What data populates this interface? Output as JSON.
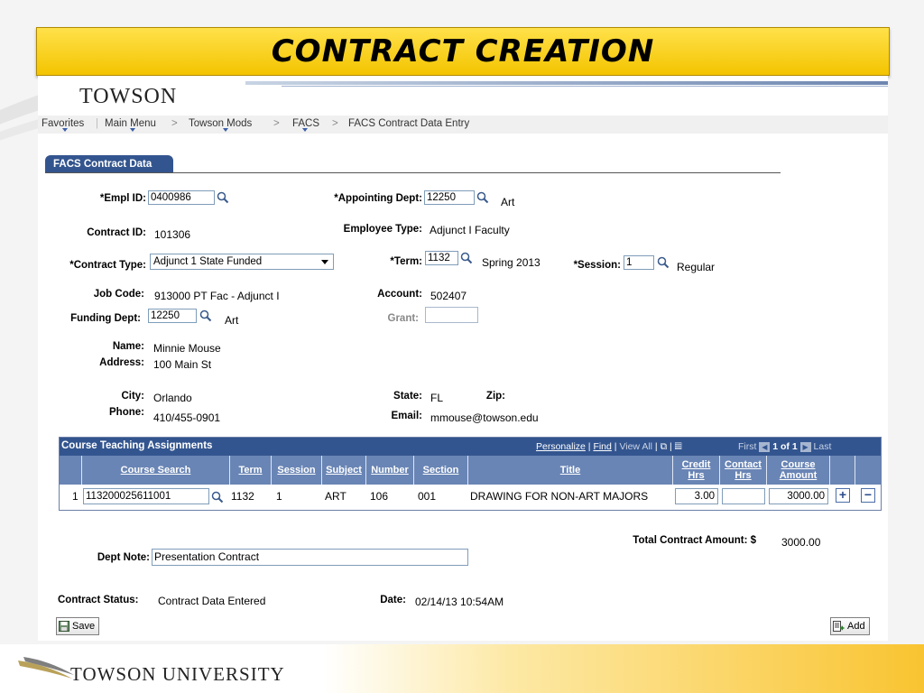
{
  "slide": {
    "title": "CONTRACT CREATION",
    "footer_logo": "TOWSON UNIVERSITY"
  },
  "app": {
    "logo": "TOWSON"
  },
  "nav": {
    "favorites": "Favorites",
    "main_menu": "Main Menu",
    "mods": "Towson Mods",
    "facs": "FACS",
    "page": "FACS Contract Data Entry",
    "sep": ">"
  },
  "tab": {
    "label": "FACS Contract Data"
  },
  "form": {
    "empl_id_label": "*Empl ID:",
    "empl_id": "0400986",
    "appt_dept_label": "*Appointing Dept:",
    "appt_dept": "12250",
    "appt_dept_name": "Art",
    "contract_id_label": "Contract ID:",
    "contract_id": "101306",
    "emp_type_label": "Employee Type:",
    "emp_type": "Adjunct I Faculty",
    "contract_type_label": "*Contract Type:",
    "contract_type": "Adjunct 1 State Funded",
    "term_label": "*Term:",
    "term": "1132",
    "term_name": "Spring 2013",
    "session_label": "*Session:",
    "session": "1",
    "session_name": "Regular",
    "job_code_label": "Job Code:",
    "job_code": "913000  PT Fac - Adjunct I",
    "account_label": "Account:",
    "account": "502407",
    "funding_dept_label": "Funding Dept:",
    "funding_dept": "12250",
    "funding_dept_name": "Art",
    "grant_label": "Grant:",
    "grant": "",
    "name_label": "Name:",
    "name": "Minnie Mouse",
    "address_label": "Address:",
    "address": "100 Main St",
    "city_label": "City:",
    "city": "Orlando",
    "state_label": "State:",
    "state": "FL",
    "zip_label": "Zip:",
    "phone_label": "Phone:",
    "phone": "410/455-0901",
    "email_label": "Email:",
    "email": "mmouse@towson.edu"
  },
  "grid": {
    "title": "Course Teaching Assignments",
    "personalize": "Personalize",
    "find": "Find",
    "view_all": "View All",
    "first": "First",
    "range": "1 of 1",
    "last": "Last",
    "columns": [
      "Course Search",
      "Term",
      "Session",
      "Subject",
      "Number",
      "Section",
      "Title",
      "Credit Hrs",
      "Contact Hrs",
      "Course Amount"
    ],
    "rows": [
      {
        "num": "1",
        "course": "113200025611001",
        "term": "1132",
        "session": "1",
        "subject": "ART",
        "number": "106",
        "section": "001",
        "title": "DRAWING FOR NON-ART MAJORS",
        "credit": "3.00",
        "contact": "",
        "amount": "3000.00"
      }
    ]
  },
  "totals": {
    "label": "Total Contract Amount: $",
    "value": "3000.00"
  },
  "dept_note": {
    "label": "Dept Note:",
    "value": "Presentation Contract"
  },
  "status": {
    "label": "Contract Status:",
    "value": "Contract Data Entered",
    "date_label": "Date:",
    "date": "02/14/13 10:54AM"
  },
  "buttons": {
    "save": "Save",
    "add": "Add"
  }
}
